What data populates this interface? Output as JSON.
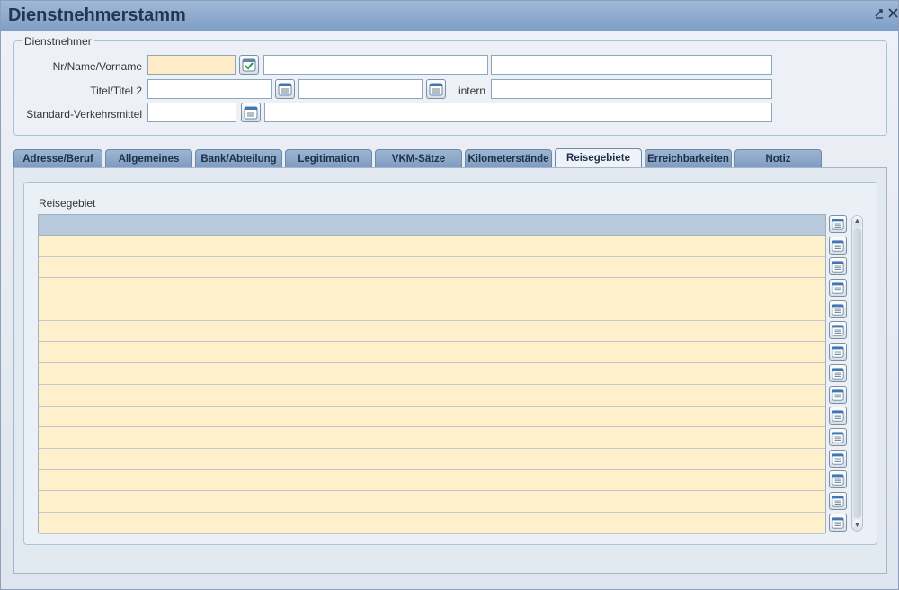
{
  "window": {
    "title": "Dienstnehmerstamm",
    "pin_icon": "pin-icon",
    "close_icon": "close-icon"
  },
  "dienstnehmer": {
    "legend": "Dienstnehmer",
    "row1_label": "Nr/Name/Vorname",
    "row2_label": "Titel/Titel 2",
    "row2_intern_label": "intern",
    "row3_label": "Standard-Verkehrsmittel",
    "nr_value": "",
    "name_value": "",
    "vorname_value": "",
    "titel_value": "",
    "titel2_value": "",
    "intern_value": "",
    "verkehrsmittel_value": "",
    "verkehrsmittel_desc_value": ""
  },
  "tabs": [
    {
      "label": "Adresse/Beruf",
      "active": false
    },
    {
      "label": "Allgemeines",
      "active": false
    },
    {
      "label": "Bank/Abteilung",
      "active": false
    },
    {
      "label": "Legitimation",
      "active": false
    },
    {
      "label": "VKM-Sätze",
      "active": false
    },
    {
      "label": "Kilometerstände",
      "active": false
    },
    {
      "label": "Reisegebiete",
      "active": true
    },
    {
      "label": "Erreichbarkeiten",
      "active": false
    },
    {
      "label": "Notiz",
      "active": false
    }
  ],
  "reisegebiete": {
    "caption": "Reisegebiet",
    "row_count": 14
  },
  "colors": {
    "titlebar": "#8aa7cb",
    "required_field": "#fdecc5",
    "grid_row": "#fdf0ca",
    "grid_header": "#b8c9dc",
    "tab": "#8aa7cb"
  }
}
